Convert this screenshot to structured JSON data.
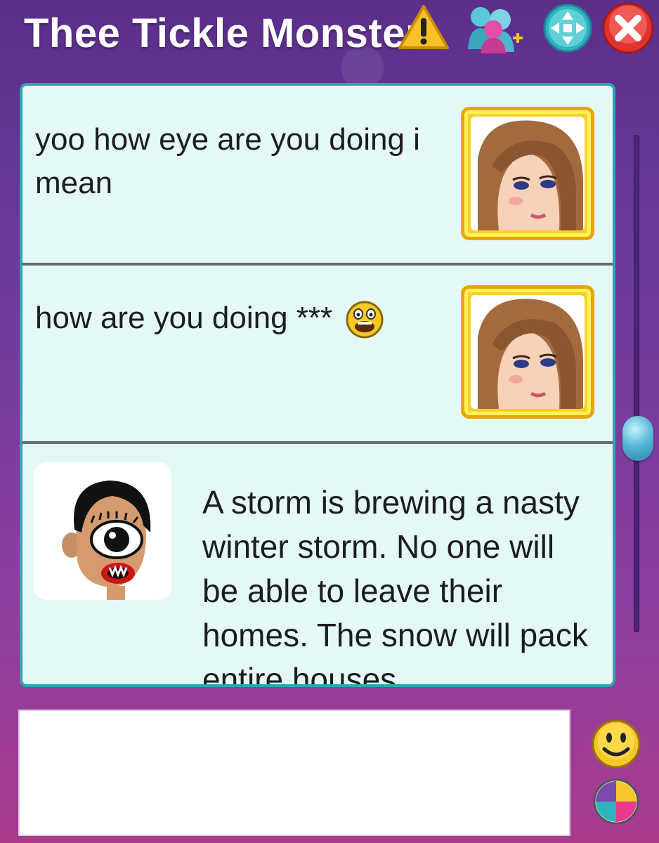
{
  "window": {
    "title": "Thee Tickle Monster",
    "icons": [
      "warning-icon",
      "add-buddy-icon",
      "move-icon",
      "close-icon"
    ]
  },
  "messages": [
    {
      "text": "yoo how eye are you doing i mean",
      "avatar": "girl-avatar"
    },
    {
      "text": "how are you doing ***",
      "emoji": "laughing-emoji",
      "avatar": "girl-avatar"
    },
    {
      "text": "A storm is brewing a nasty winter storm. No one will be able to leave their homes. The snow will pack entire houses",
      "avatar": "cyclops-avatar"
    }
  ],
  "input": {
    "value": ""
  },
  "toolbar": {
    "buttons": [
      "smiley-icon",
      "color-palette-icon"
    ]
  },
  "colors": {
    "accent": "#2fa5b0",
    "frame_gold": "#ffcf2a",
    "chat_bg": "#e3f8f7"
  }
}
